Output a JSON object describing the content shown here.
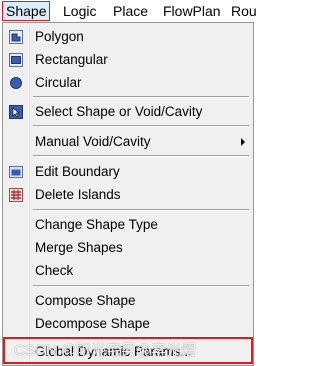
{
  "menubar": {
    "items": [
      "Shape",
      "Logic",
      "Place",
      "FlowPlan",
      "Rou"
    ]
  },
  "menu": {
    "polygon": "Polygon",
    "rectangular": "Rectangular",
    "circular": "Circular",
    "select_shape": "Select Shape or Void/Cavity",
    "manual_void": "Manual Void/Cavity",
    "edit_boundary": "Edit Boundary",
    "delete_islands": "Delete Islands",
    "change_shape_type": "Change Shape Type",
    "merge_shapes": "Merge Shapes",
    "check": "Check",
    "compose_shape": "Compose Shape",
    "decompose_shape": "Decompose Shape",
    "global_dynamic_params": "Global Dynamic Params..."
  },
  "watermark": "CSDN @阳光宅男@李光熠",
  "colors": {
    "highlight_border": "#d81e1e",
    "menu_bg": "#f0f0f0"
  }
}
